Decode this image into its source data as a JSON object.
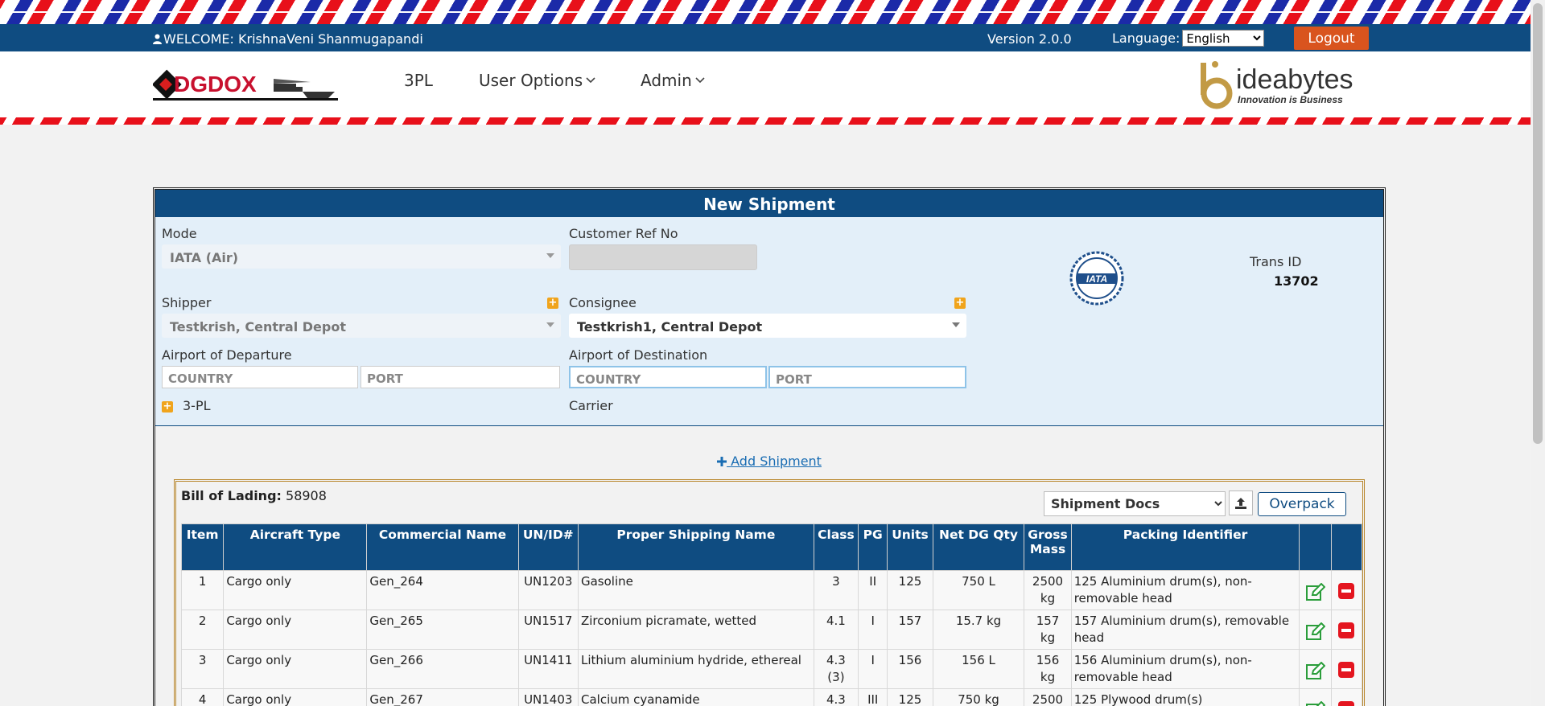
{
  "header": {
    "welcome": "WELCOME: KrishnaVeni Shanmugapandi",
    "version": "Version 2.0.0",
    "language_label": "Language:",
    "language_value": "English",
    "logout_label": "Logout"
  },
  "nav": {
    "logo_text": "DGDOX",
    "items": [
      "3PL",
      "User Options",
      "Admin"
    ],
    "partner_logo": "ideabytes",
    "partner_tagline": "Innovation is Business"
  },
  "form": {
    "title": "New Shipment",
    "mode_label": "Mode",
    "mode_value": "IATA (Air)",
    "customer_ref_label": "Customer Ref No",
    "iata_logo_text": "IATA",
    "trans_id_label": "Trans ID",
    "trans_id_value": "13702",
    "shipper_label": "Shipper",
    "shipper_value": "Testkrish, Central Depot",
    "consignee_label": "Consignee",
    "consignee_value": "Testkrish1, Central Depot",
    "departure_label": "Airport of Departure",
    "destination_label": "Airport of Destination",
    "country_placeholder": "COUNTRY",
    "port_placeholder": "PORT",
    "threepl_label": "3-PL",
    "carrier_label": "Carrier",
    "add_shipment_label": "Add Shipment"
  },
  "bol": {
    "label": "Bill of Lading:",
    "value": "58908",
    "docs_value": "Shipment Docs",
    "overpack_label": "Overpack"
  },
  "table": {
    "headers": [
      "Item",
      "Aircraft Type",
      "Commercial Name",
      "UN/ID#",
      "Proper Shipping Name",
      "Class",
      "PG",
      "Units",
      "Net DG Qty",
      "Gross Mass",
      "Packing Identifier"
    ],
    "rows": [
      {
        "item": "1",
        "aircraft": "Cargo only",
        "commercial": "Gen_264",
        "un": "UN1203",
        "psn": "Gasoline",
        "class": "3",
        "pg": "II",
        "units": "125",
        "net": "750 L",
        "gross": "2500 kg",
        "packing": "125 Aluminium drum(s), non-removable head"
      },
      {
        "item": "2",
        "aircraft": "Cargo only",
        "commercial": "Gen_265",
        "un": "UN1517",
        "psn": "Zirconium picramate, wetted",
        "class": "4.1",
        "pg": "I",
        "units": "157",
        "net": "15.7 kg",
        "gross": "157 kg",
        "packing": "157 Aluminium drum(s), removable head"
      },
      {
        "item": "3",
        "aircraft": "Cargo only",
        "commercial": "Gen_266",
        "un": "UN1411",
        "psn": "Lithium aluminium hydride, ethereal",
        "class": "4.3 (3)",
        "pg": "I",
        "units": "156",
        "net": "156 L",
        "gross": "156 kg",
        "packing": "156 Aluminium drum(s), non-removable head"
      },
      {
        "item": "4",
        "aircraft": "Cargo only",
        "commercial": "Gen_267",
        "un": "UN1403",
        "psn": "Calcium cyanamide",
        "class": "4.3",
        "pg": "III",
        "units": "125",
        "net": "750 kg",
        "gross": "2500",
        "packing": "125 Plywood drum(s)"
      }
    ]
  },
  "colors": {
    "primary": "#0f4c81",
    "accent": "#d9541e",
    "form_bg": "#e3eff9",
    "delete": "#e4151f",
    "edit": "#2a9d3a"
  }
}
